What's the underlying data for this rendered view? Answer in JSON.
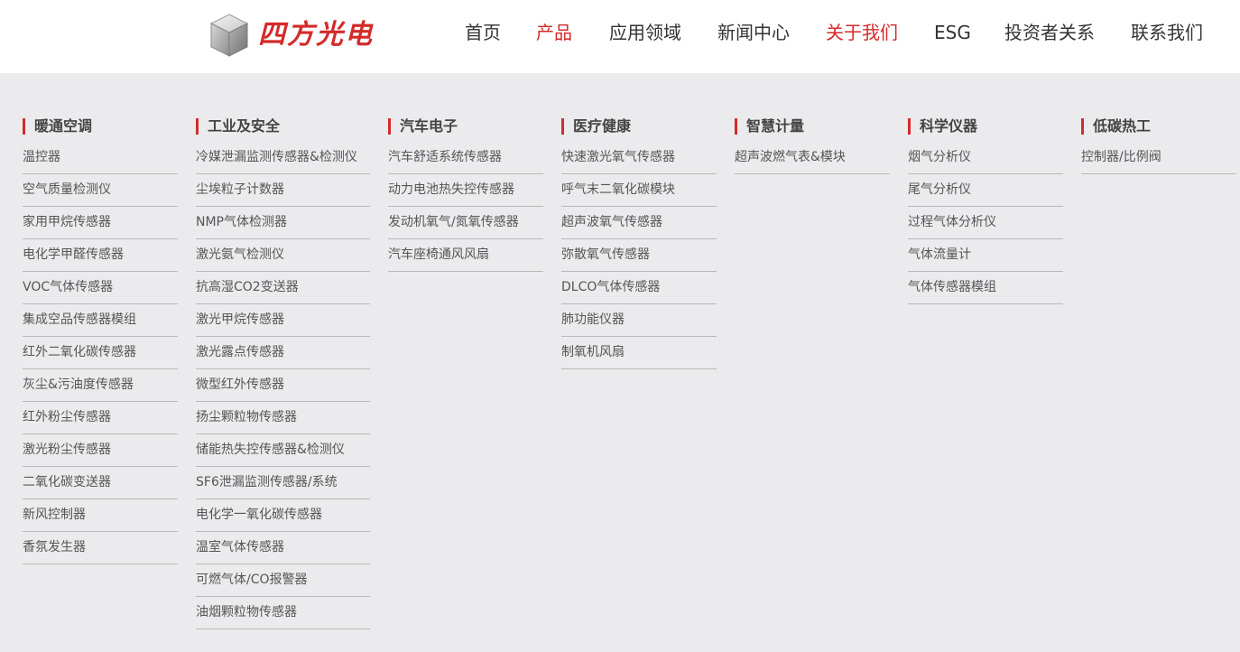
{
  "brand": {
    "name": "四方光电"
  },
  "nav": [
    {
      "label": "首页",
      "active": false
    },
    {
      "label": "产品",
      "active": true
    },
    {
      "label": "应用领域",
      "active": false
    },
    {
      "label": "新闻中心",
      "active": false
    },
    {
      "label": "关于我们",
      "active": true
    },
    {
      "label": "ESG",
      "active": false
    },
    {
      "label": "投资者关系",
      "active": false
    },
    {
      "label": "联系我们",
      "active": false
    }
  ],
  "colors": {
    "accent": "#d42a2a",
    "background": "#ebebed",
    "text": "#555555"
  },
  "categories": [
    {
      "title": "暖通空调",
      "items": [
        "温控器",
        "空气质量检测仪",
        "家用甲烷传感器",
        "电化学甲醛传感器",
        "VOC气体传感器",
        "集成空品传感器模组",
        "红外二氧化碳传感器",
        "灰尘&污油度传感器",
        "红外粉尘传感器",
        "激光粉尘传感器",
        "二氧化碳变送器",
        "新风控制器",
        "香氛发生器"
      ]
    },
    {
      "title": "工业及安全",
      "items": [
        "冷媒泄漏监测传感器&检测仪",
        "尘埃粒子计数器",
        "NMP气体检测器",
        "激光氨气检测仪",
        "抗高湿CO2变送器",
        "激光甲烷传感器",
        "激光露点传感器",
        "微型红外传感器",
        "扬尘颗粒物传感器",
        "储能热失控传感器&检测仪",
        "SF6泄漏监测传感器/系统",
        "电化学一氧化碳传感器",
        "温室气体传感器",
        "可燃气体/CO报警器",
        "油烟颗粒物传感器"
      ]
    },
    {
      "title": "汽车电子",
      "items": [
        "汽车舒适系统传感器",
        "动力电池热失控传感器",
        "发动机氧气/氮氧传感器",
        "汽车座椅通风风扇"
      ]
    },
    {
      "title": "医疗健康",
      "items": [
        "快速激光氧气传感器",
        "呼气末二氧化碳模块",
        "超声波氧气传感器",
        "弥散氧气传感器",
        "DLCO气体传感器",
        "肺功能仪器",
        "制氧机风扇"
      ]
    },
    {
      "title": "智慧计量",
      "items": [
        "超声波燃气表&模块"
      ]
    },
    {
      "title": "科学仪器",
      "items": [
        "烟气分析仪",
        "尾气分析仪",
        "过程气体分析仪",
        "气体流量计",
        "气体传感器模组"
      ]
    },
    {
      "title": "低碳热工",
      "items": [
        "控制器/比例阀"
      ]
    }
  ]
}
